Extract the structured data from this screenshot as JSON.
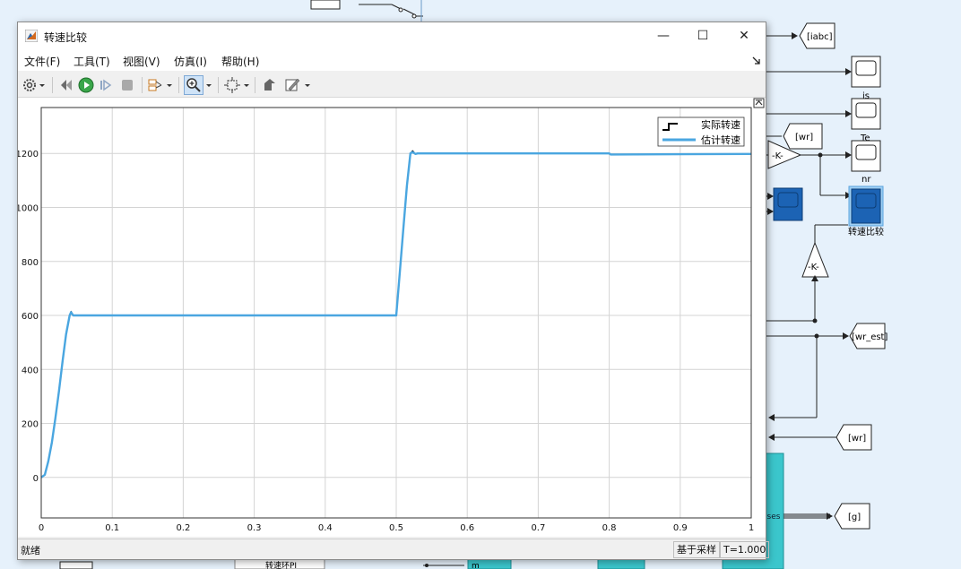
{
  "window": {
    "title": "转速比较",
    "controls": {
      "minimize": "—",
      "maximize": "☐",
      "close": "✕"
    },
    "menu": [
      "文件(F)",
      "工具(T)",
      "视图(V)",
      "仿真(I)",
      "帮助(H)"
    ],
    "toolbar_icons": [
      "gear-icon",
      "restore-icon",
      "run-icon",
      "step-forward-icon",
      "stop-icon",
      "signal-selector-icon",
      "zoom-in-icon",
      "autoscale-icon",
      "highlight-icon",
      "style-icon"
    ],
    "status_left": "就绪",
    "status_sample": "基于采样",
    "status_time": "T=1.000"
  },
  "chart_data": {
    "type": "line",
    "title": "",
    "xlabel": "",
    "ylabel": "",
    "xlim": [
      0,
      1
    ],
    "ylim": [
      -150,
      1370
    ],
    "xticks": [
      "0",
      "0.1",
      "0.2",
      "0.3",
      "0.4",
      "0.5",
      "0.6",
      "0.7",
      "0.8",
      "0.9",
      "1"
    ],
    "yticks": [
      "0",
      "200",
      "400",
      "600",
      "800",
      "1000",
      "1200"
    ],
    "grid": true,
    "legend_position": "top-right",
    "series": [
      {
        "name": "实际转速",
        "color": "#000000",
        "x": [
          0,
          0.005,
          0.01,
          0.015,
          0.02,
          0.025,
          0.03,
          0.035,
          0.04,
          0.042,
          0.045,
          0.05,
          0.5,
          0.505,
          0.51,
          0.515,
          0.52,
          0.523,
          0.527,
          0.53,
          0.8,
          0.802,
          1.0
        ],
        "y": [
          0,
          10,
          60,
          130,
          220,
          320,
          430,
          530,
          600,
          615,
          600,
          600,
          600,
          760,
          920,
          1080,
          1200,
          1210,
          1198,
          1200,
          1200,
          1196,
          1198
        ]
      },
      {
        "name": "估计转速",
        "color": "#4aa6e0",
        "x": [
          0,
          0.005,
          0.01,
          0.015,
          0.02,
          0.025,
          0.03,
          0.035,
          0.04,
          0.042,
          0.045,
          0.05,
          0.5,
          0.505,
          0.51,
          0.515,
          0.52,
          0.523,
          0.527,
          0.53,
          0.8,
          0.802,
          1.0
        ],
        "y": [
          0,
          10,
          60,
          130,
          220,
          320,
          430,
          530,
          600,
          612,
          600,
          600,
          600,
          760,
          920,
          1080,
          1200,
          1205,
          1198,
          1200,
          1200,
          1196,
          1198
        ]
      }
    ]
  },
  "background_model": {
    "tags": [
      "[iabc]",
      "[wr]",
      "[wr_est]",
      "[wr]",
      "[g]"
    ],
    "scope_labels": [
      "is",
      "Te",
      "nr",
      "转速比较"
    ],
    "gains": [
      "-K-",
      "-K-"
    ],
    "partial_labels": [
      "转速环PI",
      "lses",
      "m"
    ]
  }
}
